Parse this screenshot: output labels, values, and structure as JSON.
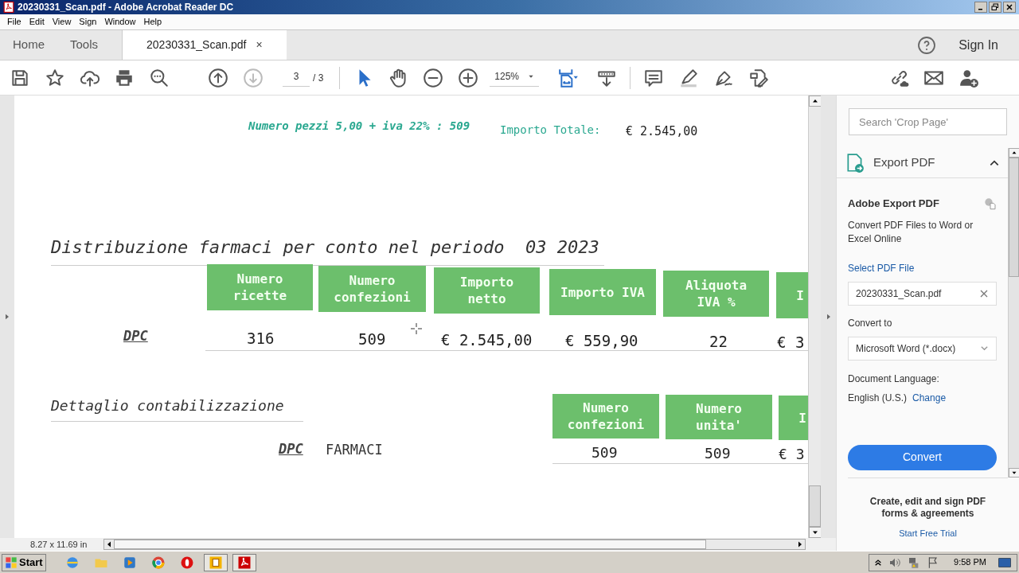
{
  "window": {
    "title": "20230331_Scan.pdf - Adobe Acrobat Reader DC"
  },
  "menu": [
    "File",
    "Edit",
    "View",
    "Sign",
    "Window",
    "Help"
  ],
  "tabs": [
    {
      "label": "Home",
      "selected": false
    },
    {
      "label": "Tools",
      "selected": false
    },
    {
      "label": "20230331_Scan.pdf",
      "selected": true,
      "close": "×"
    }
  ],
  "sign_in": "Sign In",
  "toolbar": {
    "page_current": "3",
    "page_total": "/ 3",
    "zoom": "125%"
  },
  "document": {
    "summary": {
      "pieces": "Numero pezzi 5,00 + iva 22% : 509",
      "total_label": "Importo Totale:",
      "total": "€ 2.545,00"
    },
    "section_1": {
      "title": "Distribuzione farmaci per conto nel periodo  03 2023",
      "columns": [
        "Numero ricette",
        "Numero confezioni",
        "Importo netto",
        "Importo IVA",
        "Aliquota IVA %",
        "I"
      ],
      "row_label": "DPC",
      "cells": [
        "316",
        "509",
        "€ 2.545,00",
        "€ 559,90",
        "22",
        "€ 3"
      ]
    },
    "section_2": {
      "title": "Dettaglio contabilizzazione",
      "row_label": "DPC",
      "row_sublabel": "FARMACI",
      "columns": [
        "Numero confezioni",
        "Numero unita'",
        "I"
      ],
      "cells": [
        "509",
        "509",
        "€ 3"
      ]
    },
    "page_size": "8.27 x 11.69 in"
  },
  "right_panel": {
    "search_placeholder": "Search 'Crop Page'",
    "heading": "Export PDF",
    "expanded": true,
    "title": "Adobe Export PDF",
    "description": "Convert PDF Files to Word or Excel Online",
    "select_label": "Select PDF File",
    "file_name": "20230331_Scan.pdf",
    "convert_to_label": "Convert to",
    "format": "Microsoft Word (*.docx)",
    "language_label": "Document Language:",
    "language": "English (U.S.)",
    "change_link": "Change",
    "convert_button": "Convert",
    "promo": "Create, edit and sign PDF forms & agreements",
    "trial_link": "Start Free Trial"
  },
  "taskbar": {
    "start": "Start",
    "time": "9:58 PM"
  }
}
